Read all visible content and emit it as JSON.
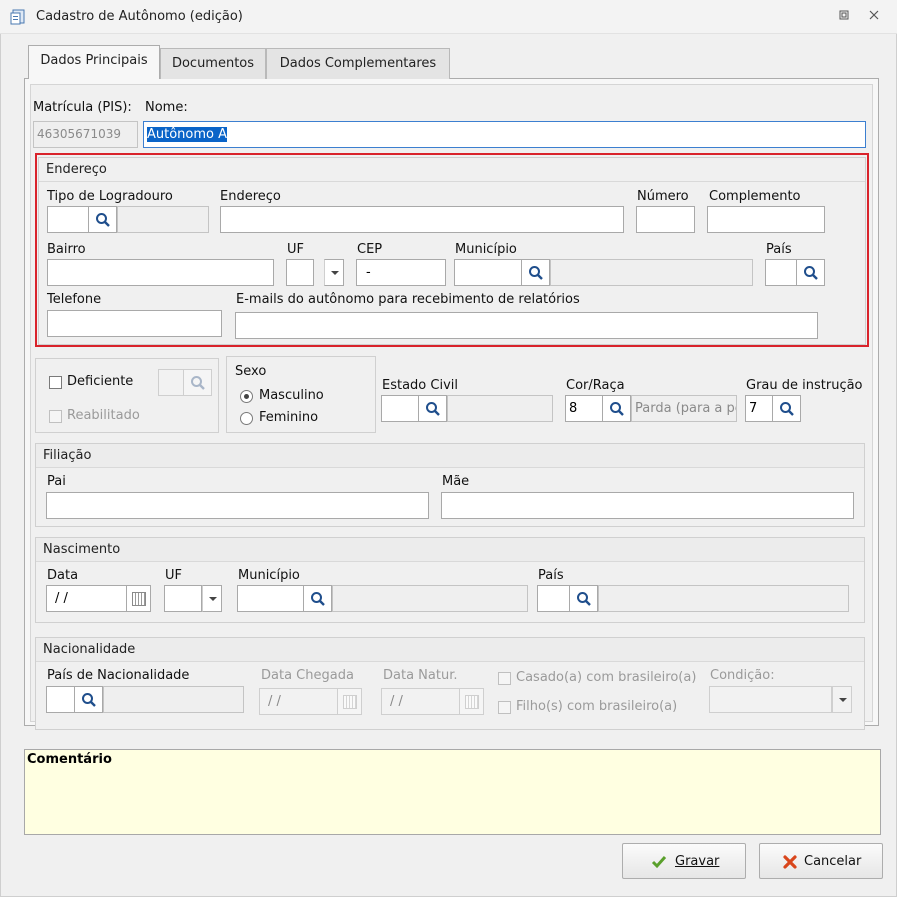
{
  "window": {
    "title": "Cadastro de Autônomo (edição)"
  },
  "tabs": [
    "Dados Principais",
    "Documentos",
    "Dados Complementares"
  ],
  "main": {
    "matricula_label": "Matrícula (PIS):",
    "matricula_value": "46305671039",
    "nome_label": "Nome:",
    "nome_value": "Autônomo A"
  },
  "endereco": {
    "title": "Endereço",
    "tipo_logradouro_label": "Tipo de Logradouro",
    "endereco_label": "Endereço",
    "numero_label": "Número",
    "complemento_label": "Complemento",
    "bairro_label": "Bairro",
    "uf_label": "UF",
    "cep_label": "CEP",
    "cep_value": "-",
    "municipio_label": "Município",
    "pais_label": "País",
    "telefone_label": "Telefone",
    "emails_label": "E-mails do autônomo para recebimento de relatórios"
  },
  "deficiente": {
    "deficiente_label": "Deficiente",
    "reabilitado_label": "Reabilitado"
  },
  "sexo": {
    "title": "Sexo",
    "masculino": "Masculino",
    "feminino": "Feminino",
    "selected": "Masculino"
  },
  "estado_civil": {
    "label": "Estado Civil"
  },
  "cor_raca": {
    "label": "Cor/Raça",
    "code": "8",
    "description": "Parda (para a pe"
  },
  "grau_instrucao": {
    "label": "Grau de instrução",
    "code": "7"
  },
  "filiacao": {
    "title": "Filiação",
    "pai_label": "Pai",
    "mae_label": "Mãe"
  },
  "nascimento": {
    "title": "Nascimento",
    "data_label": "Data",
    "data_value": "/ /",
    "uf_label": "UF",
    "municipio_label": "Município",
    "pais_label": "País"
  },
  "nacionalidade": {
    "title": "Nacionalidade",
    "pais_label": "País de Nacionalidade",
    "data_chegada_label": "Data Chegada",
    "data_chegada_value": "/ /",
    "data_natur_label": "Data Natur.",
    "data_natur_value": "/ /",
    "casado_label": "Casado(a) com brasileiro(a)",
    "filhos_label": "Filho(s) com brasileiro(a)",
    "condicao_label": "Condição:"
  },
  "comentario": {
    "label": "Comentário"
  },
  "buttons": {
    "gravar": "Gravar",
    "cancelar": "Cancelar"
  },
  "colors": {
    "highlight_border": "#d9232b",
    "comment_bg": "#ffffe1",
    "selection": "#0a64c8",
    "check_green": "#5aa02c",
    "cancel_red": "#d9461c"
  }
}
